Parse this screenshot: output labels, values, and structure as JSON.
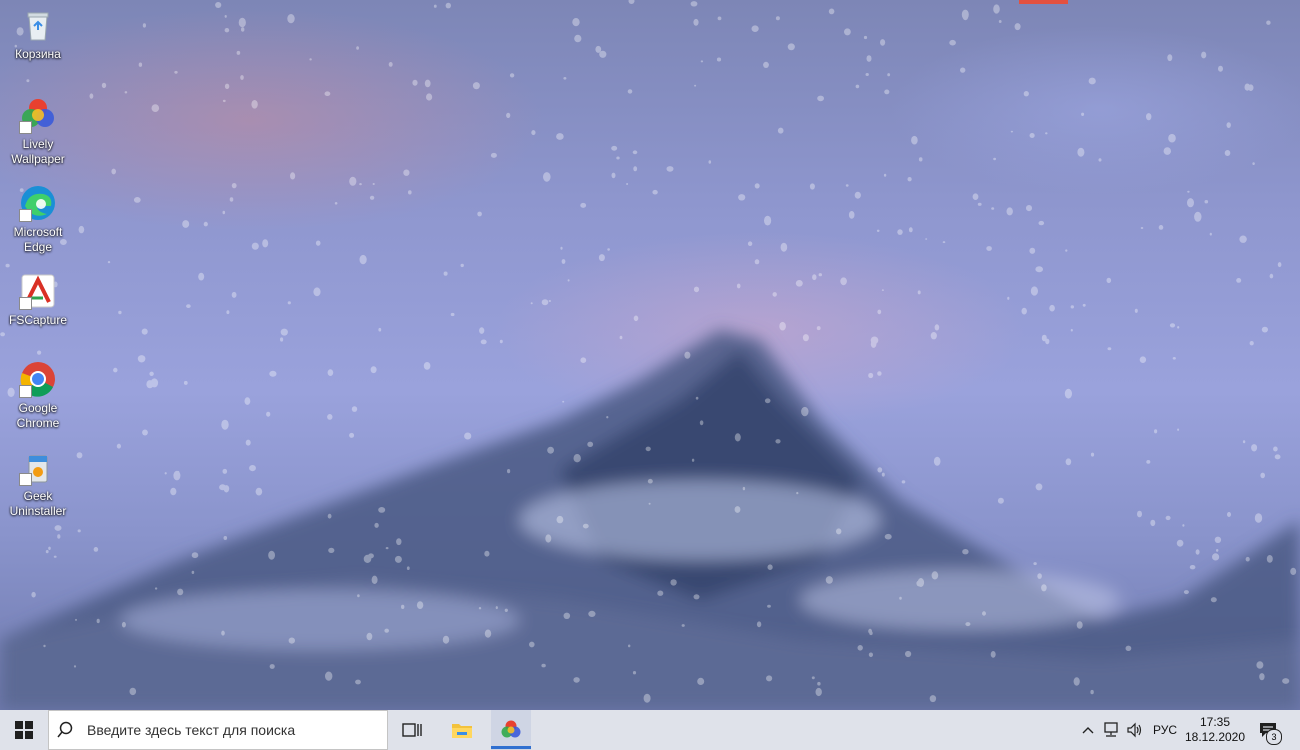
{
  "desktop": {
    "icons": [
      {
        "label": "Корзина",
        "icon": "recycle-bin-icon"
      },
      {
        "label": "Lively\nWallpaper",
        "icon": "lively-wallpaper-icon"
      },
      {
        "label": "Microsoft\nEdge",
        "icon": "edge-icon"
      },
      {
        "label": "FSCapture",
        "icon": "fscapture-icon"
      },
      {
        "label": "Google\nChrome",
        "icon": "chrome-icon"
      },
      {
        "label": "Geek\nUninstaller",
        "icon": "geek-uninstaller-icon"
      }
    ]
  },
  "taskbar": {
    "search_placeholder": "Введите здесь текст для поиска",
    "language": "РУС",
    "time": "17:35",
    "date": "18.12.2020",
    "notification_count": "3"
  },
  "colors": {
    "taskbar_bg": "#dfe2ea",
    "accent": "#2f6fd0",
    "windows_blue": "#0078d7"
  }
}
